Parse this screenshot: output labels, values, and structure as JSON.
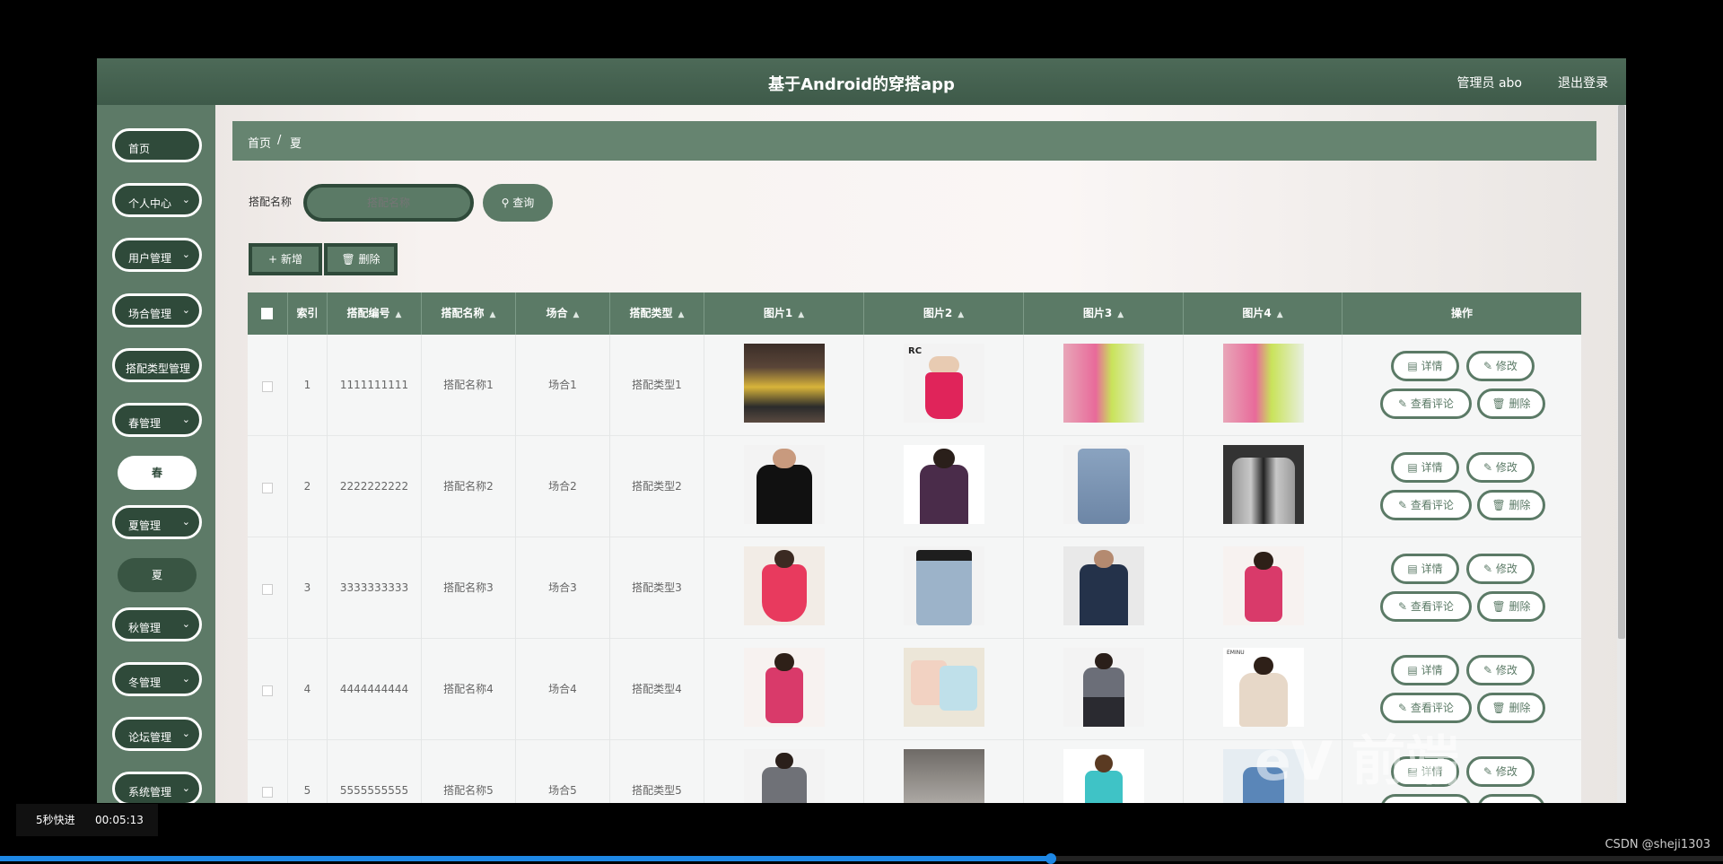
{
  "header": {
    "title": "基于Android的穿搭app",
    "user": "管理员 abo",
    "logout": "退出登录"
  },
  "sidebar": {
    "items": [
      {
        "label": "首页"
      },
      {
        "label": "个人中心"
      },
      {
        "label": "用户管理"
      },
      {
        "label": "场合管理"
      },
      {
        "label": "搭配类型管理"
      },
      {
        "label": "春管理"
      },
      {
        "label": "春"
      },
      {
        "label": "夏管理"
      },
      {
        "label": "夏"
      },
      {
        "label": "秋管理"
      },
      {
        "label": "冬管理"
      },
      {
        "label": "论坛管理"
      },
      {
        "label": "系统管理"
      }
    ]
  },
  "breadcrumb": {
    "home": "首页",
    "sep": "/",
    "current": "夏"
  },
  "search": {
    "label": "搭配名称",
    "placeholder": "搭配名称",
    "button": "查询",
    "icon": "search-icon"
  },
  "toolbar": {
    "add": "新增",
    "delete": "删除"
  },
  "table": {
    "columns": [
      "索引",
      "搭配编号",
      "搭配名称",
      "场合",
      "搭配类型",
      "图片1",
      "图片2",
      "图片3",
      "图片4",
      "操作"
    ],
    "rows": [
      {
        "index": "1",
        "code": "1111111111",
        "name": "搭配名称1",
        "occasion": "场合1",
        "type": "搭配类型1"
      },
      {
        "index": "2",
        "code": "2222222222",
        "name": "搭配名称2",
        "occasion": "场合2",
        "type": "搭配类型2"
      },
      {
        "index": "3",
        "code": "3333333333",
        "name": "搭配名称3",
        "occasion": "场合3",
        "type": "搭配类型3"
      },
      {
        "index": "4",
        "code": "4444444444",
        "name": "搭配名称4",
        "occasion": "场合4",
        "type": "搭配类型4"
      },
      {
        "index": "5",
        "code": "5555555555",
        "name": "搭配名称5",
        "occasion": "场合5",
        "type": "搭配类型5"
      }
    ],
    "actions": {
      "detail": "详情",
      "edit": "修改",
      "comments": "查看评论",
      "delete": "删除"
    },
    "image_labels": {
      "r1c2": "RC",
      "r4c4": "EMINU"
    }
  },
  "player": {
    "skip": "5秒快进",
    "time": "00:05:13",
    "progress_fraction": 0.61
  },
  "watermark": {
    "text": "eV 前端"
  },
  "credit": "CSDN @sheji1303",
  "colors": {
    "brand": "#5b7a66",
    "dark": "#2f4a3a",
    "progress": "#1e88e5"
  }
}
